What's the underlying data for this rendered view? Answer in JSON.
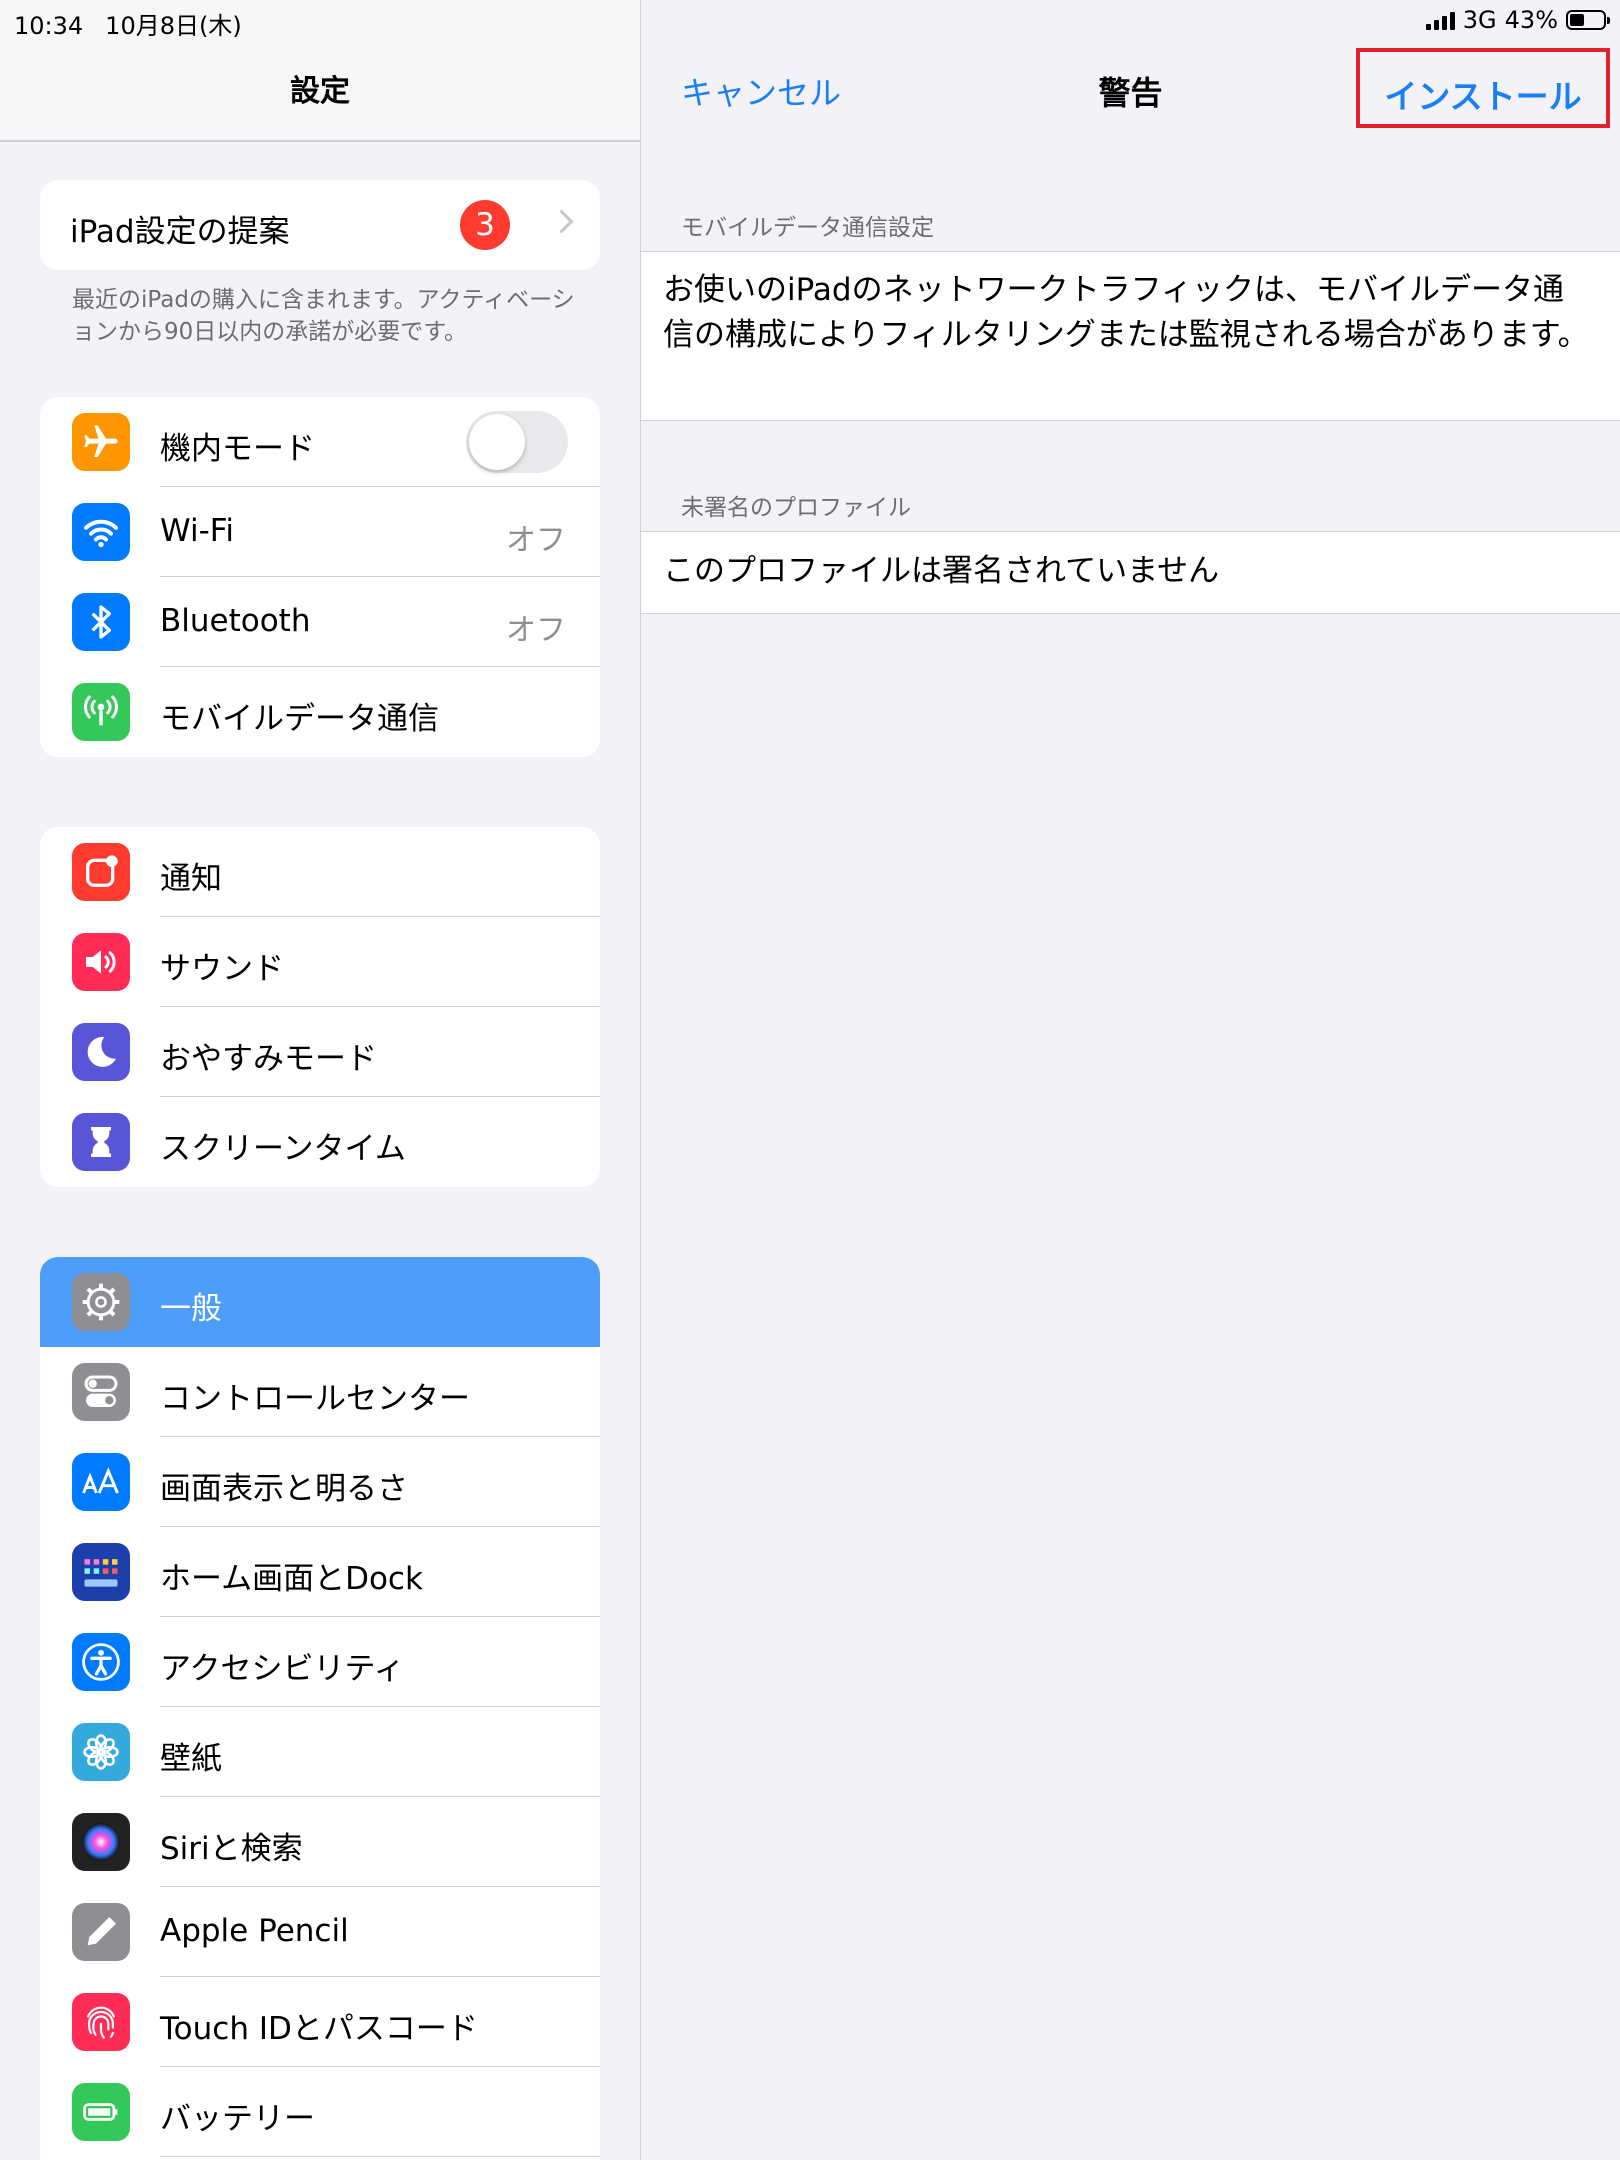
{
  "status_bar": {
    "time": "10:34",
    "date": "10月8日(木)",
    "network": "3G",
    "battery": "43%",
    "battery_level": 0.43
  },
  "settings": {
    "title": "設定",
    "suggestion": {
      "label": "iPad設定の提案",
      "badge": "3",
      "note": "最近のiPadの購入に含まれます。アクティベーションから90日以内の承諾が必要です。"
    },
    "group1": [
      {
        "label": "機内モード",
        "icon": "airplane-icon",
        "color": "#ff9500",
        "toggle": false
      },
      {
        "label": "Wi-Fi",
        "icon": "wifi-icon",
        "color": "#007aff",
        "value": "オフ"
      },
      {
        "label": "Bluetooth",
        "icon": "bluetooth-icon",
        "color": "#007aff",
        "value": "オフ"
      },
      {
        "label": "モバイルデータ通信",
        "icon": "antenna-icon",
        "color": "#34c759"
      }
    ],
    "group2": [
      {
        "label": "通知",
        "icon": "notification-icon",
        "color": "#ff3b30"
      },
      {
        "label": "サウンド",
        "icon": "speaker-icon",
        "color": "#ff2d55"
      },
      {
        "label": "おやすみモード",
        "icon": "moon-icon",
        "color": "#5856d6"
      },
      {
        "label": "スクリーンタイム",
        "icon": "hourglass-icon",
        "color": "#5856d6"
      }
    ],
    "group3": [
      {
        "label": "一般",
        "icon": "gear-icon",
        "color": "#8e8e93",
        "selected": true
      },
      {
        "label": "コントロールセンター",
        "icon": "switches-icon",
        "color": "#8e8e93"
      },
      {
        "label": "画面表示と明るさ",
        "icon": "text-size-icon",
        "color": "#007aff"
      },
      {
        "label": "ホーム画面とDock",
        "icon": "home-grid-icon",
        "color": "#1c3faa"
      },
      {
        "label": "アクセシビリティ",
        "icon": "accessibility-icon",
        "color": "#007aff"
      },
      {
        "label": "壁紙",
        "icon": "flower-icon",
        "color": "#34aadc"
      },
      {
        "label": "Siriと検索",
        "icon": "siri-icon",
        "color": "#222222"
      },
      {
        "label": "Apple Pencil",
        "icon": "pencil-icon",
        "color": "#8e8e93"
      },
      {
        "label": "Touch IDとパスコード",
        "icon": "fingerprint-icon",
        "color": "#ff2d55"
      },
      {
        "label": "バッテリー",
        "icon": "battery-icon",
        "color": "#34c759"
      }
    ]
  },
  "warning": {
    "cancel": "キャンセル",
    "title": "警告",
    "install": "インストール",
    "sections": [
      {
        "header": "モバイルデータ通信設定",
        "text": "お使いのiPadのネットワークトラフィックは、モバイルデータ通信の構成によりフィルタリングまたは監視される場合があります。"
      },
      {
        "header": "未署名のプロファイル",
        "text": "このプロファイルは署名されていません"
      }
    ]
  },
  "colors": {
    "accent": "#1a7ef5",
    "selected_row": "#4e9dfa",
    "highlight_box": "#e0202a",
    "badge": "#ff3b30"
  }
}
